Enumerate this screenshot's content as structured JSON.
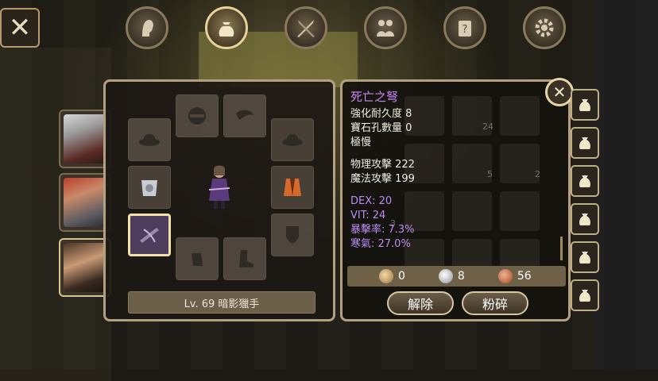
{
  "top_nav": {
    "icons": [
      "profile-icon",
      "bag-icon",
      "crossed-swords-icon",
      "party-icon",
      "quest-scroll-icon",
      "settings-gear-icon"
    ],
    "active_index": 1
  },
  "character_tabs": {
    "count": 3,
    "active_index": 2
  },
  "equipment": {
    "level_text": "Lv. 69 暗影獵手"
  },
  "item": {
    "name": "死亡之弩",
    "durability": "強化耐久度 8",
    "gem_slots": "寶石孔數量 0",
    "grade": "極慢",
    "physical_attack": "物理攻擊 222",
    "magic_attack": "魔法攻擊 199",
    "dex": "DEX: 20",
    "vit": "VIT: 24",
    "crit": "暴擊率: 7.3%",
    "frost": "寒氣: 27.0%"
  },
  "ghost_counts": [
    "24",
    "5",
    "2",
    "3"
  ],
  "currency": [
    {
      "name": "bronze-coin",
      "value": "0",
      "color": "#c9a36a"
    },
    {
      "name": "silver-coin",
      "value": "8",
      "color": "#cfd3da"
    },
    {
      "name": "copper-coin",
      "value": "56",
      "color": "#c97a5a"
    }
  ],
  "actions": {
    "unequip": "解除",
    "destroy": "粉碎"
  },
  "colors": {
    "item_name": "#c786f2",
    "bonus_stat": "#b98cf5",
    "frame": "#b3a080"
  }
}
